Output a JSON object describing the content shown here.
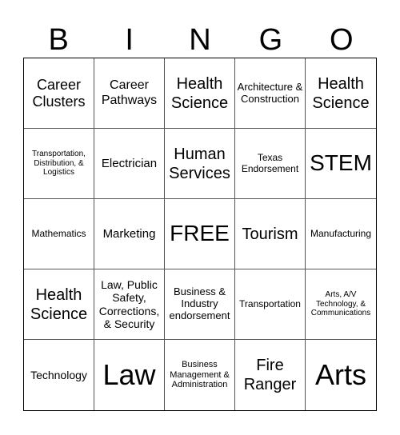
{
  "header": [
    "B",
    "I",
    "N",
    "G",
    "O"
  ],
  "cells": [
    "Career Clusters",
    "Career Pathways",
    "Health Science",
    "Architecture & Construction",
    "Health Science",
    "Transportation, Distribution, & Logistics",
    "Electrician",
    "Human Services",
    "Texas Endorsement",
    "STEM",
    "Mathematics",
    "Marketing",
    "FREE",
    "Tourism",
    "Manufacturing",
    "Health Science",
    "Law, Public Safety, Corrections, & Security",
    "Business & Industry endorsement",
    "Transportation",
    "Arts, A/V Technology, & Communications",
    "Technology",
    "Law",
    "Business Management & Administration",
    "Fire Ranger",
    "Arts"
  ]
}
